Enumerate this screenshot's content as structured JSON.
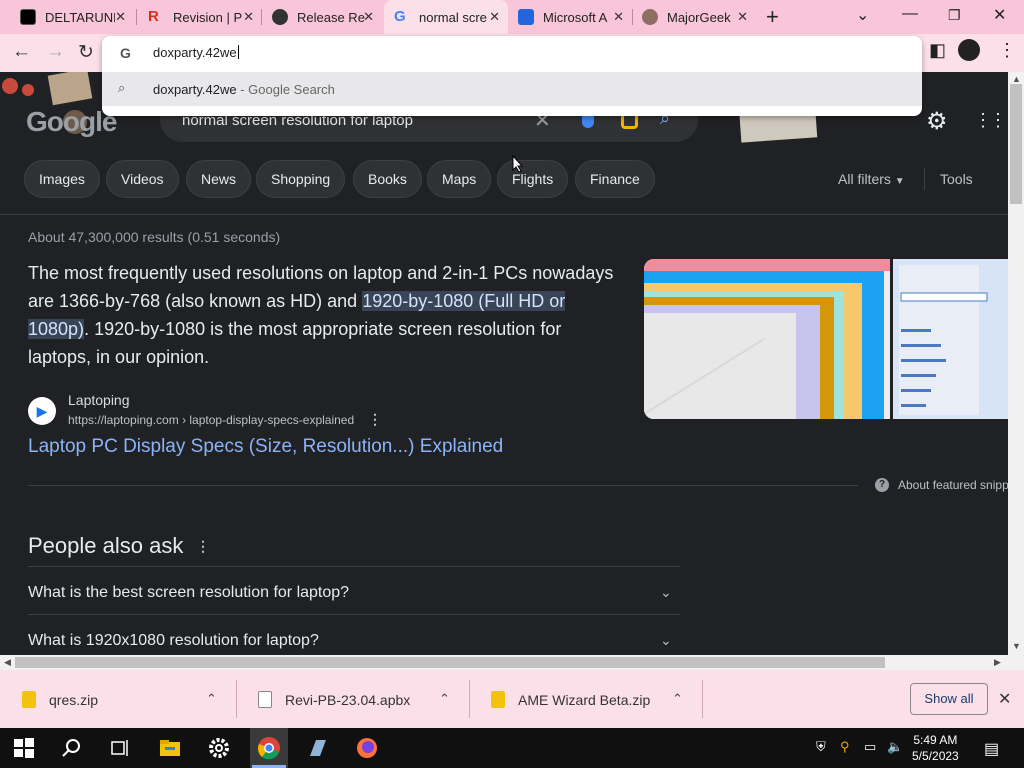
{
  "tabs": [
    {
      "label": "DELTARUNE",
      "color": "#000000"
    },
    {
      "label": "Revision | P",
      "color": "#d93025"
    },
    {
      "label": "Release Re",
      "color": "#333333"
    },
    {
      "label": "normal scre",
      "color": "#4285f4",
      "active": true
    },
    {
      "label": "Microsoft A",
      "color": "#2266dd"
    },
    {
      "label": "MajorGeek",
      "color": "#8d6e63"
    }
  ],
  "omnibox": {
    "g_icon": "G",
    "value": "doxparty.42we",
    "suggestion": "doxparty.42we",
    "suggestion_sub": " - Google Search"
  },
  "search": {
    "logo": "Google",
    "query": "normal screen resolution for laptop"
  },
  "chips": [
    "Images",
    "Videos",
    "News",
    "Shopping",
    "Books",
    "Maps",
    "Flights",
    "Finance"
  ],
  "all_filters": "All filters",
  "tools": "Tools",
  "stats": "About 47,300,000 results (0.51 seconds)",
  "snippet": {
    "pre": "The most frequently used resolutions on laptop and 2-in-1 PCs nowadays are 1366-by-768 (also known as HD) and ",
    "highlight": "1920-by-1080 (Full HD or 1080p)",
    "post": ". 1920-by-1080 is the most appropriate screen resolution for laptops, in our opinion."
  },
  "source": {
    "name": "Laptoping",
    "url": "https://laptoping.com › laptop-display-specs-explained"
  },
  "result_link": "Laptop PC Display Specs (Size, Resolution...) Explained",
  "about_featured": "About featured snipp",
  "paa": {
    "title": "People also ask",
    "questions": [
      "What is the best screen resolution for laptop?",
      "What is 1920x1080 resolution for laptop?"
    ]
  },
  "downloads": [
    {
      "name": "qres.zip",
      "color": "#f4c20d"
    },
    {
      "name": "Revi-PB-23.04.apbx",
      "color": "#ffffff"
    },
    {
      "name": "AME Wizard Beta.zip",
      "color": "#f4c20d"
    }
  ],
  "show_all": "Show all",
  "clock": {
    "time": "5:49 AM",
    "date": "5/5/2023"
  }
}
